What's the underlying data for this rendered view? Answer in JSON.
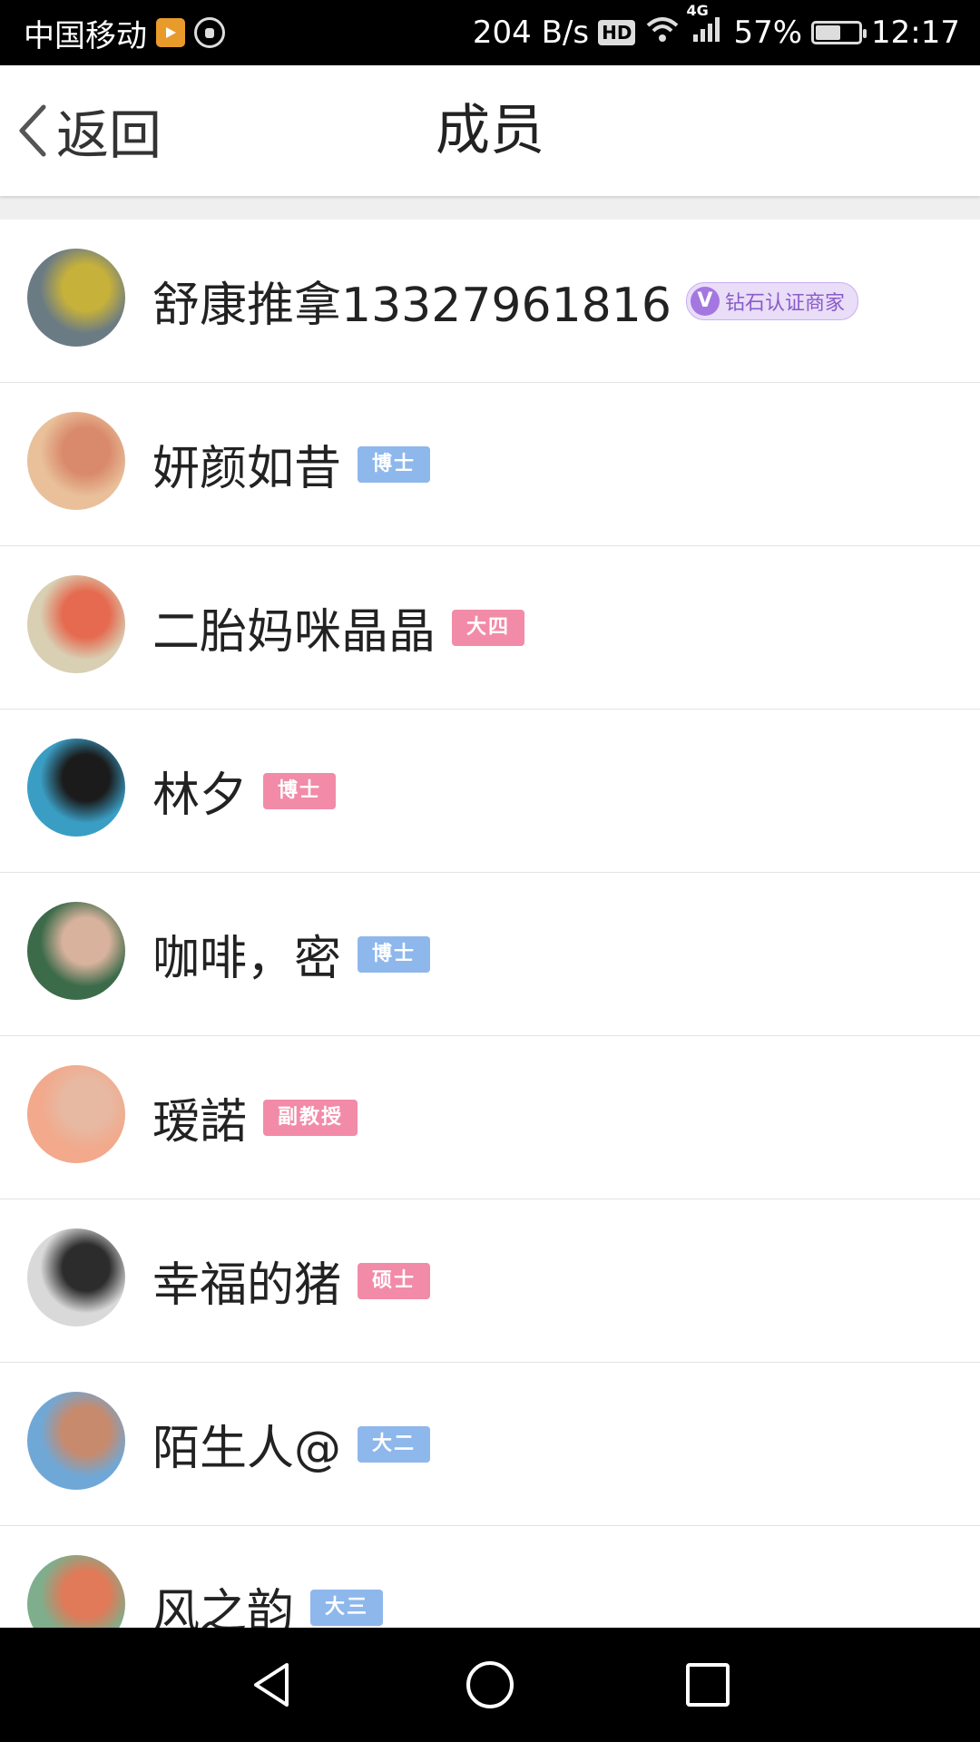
{
  "status_bar": {
    "carrier": "中国移动",
    "speed": "204 B/s",
    "hd": "HD",
    "network": "4G",
    "battery_pct_label": "57%",
    "battery_level": 0.57,
    "time": "12:17"
  },
  "header": {
    "back_label": "返回",
    "title": "成员"
  },
  "members": [
    {
      "name": "舒康推拿13327961816",
      "badge": "钻石认证商家",
      "badge_type": "vip",
      "badge_v": "V",
      "avatar_colors": [
        "#6b7b84",
        "#c6b13b"
      ]
    },
    {
      "name": "妍颜如昔",
      "badge": "博士",
      "badge_type": "blue",
      "avatar_colors": [
        "#e9c09a",
        "#d98a6c"
      ]
    },
    {
      "name": "二胎妈咪晶晶",
      "badge": "大四",
      "badge_type": "pink",
      "avatar_colors": [
        "#d9cfb3",
        "#e56a4f"
      ]
    },
    {
      "name": "林夕",
      "badge": "博士",
      "badge_type": "pink",
      "avatar_colors": [
        "#3a9ec4",
        "#1b1b1b"
      ]
    },
    {
      "name": "咖啡，密",
      "badge": "博士",
      "badge_type": "blue",
      "avatar_colors": [
        "#3c6b4a",
        "#d8b29c"
      ]
    },
    {
      "name": "瑷諾",
      "badge": "副教授",
      "badge_type": "pink",
      "avatar_colors": [
        "#f2a98c",
        "#e7b9a2"
      ]
    },
    {
      "name": "幸福的猪",
      "badge": "硕士",
      "badge_type": "pink",
      "avatar_colors": [
        "#d9d9d9",
        "#2c2c2c"
      ]
    },
    {
      "name": "陌生人@",
      "badge": "大二",
      "badge_type": "blue",
      "avatar_colors": [
        "#6fa8d6",
        "#c88a6c"
      ]
    },
    {
      "name": "风之韵",
      "badge": "大三",
      "badge_type": "blue",
      "avatar_colors": [
        "#7fae8c",
        "#e07a58"
      ]
    }
  ]
}
